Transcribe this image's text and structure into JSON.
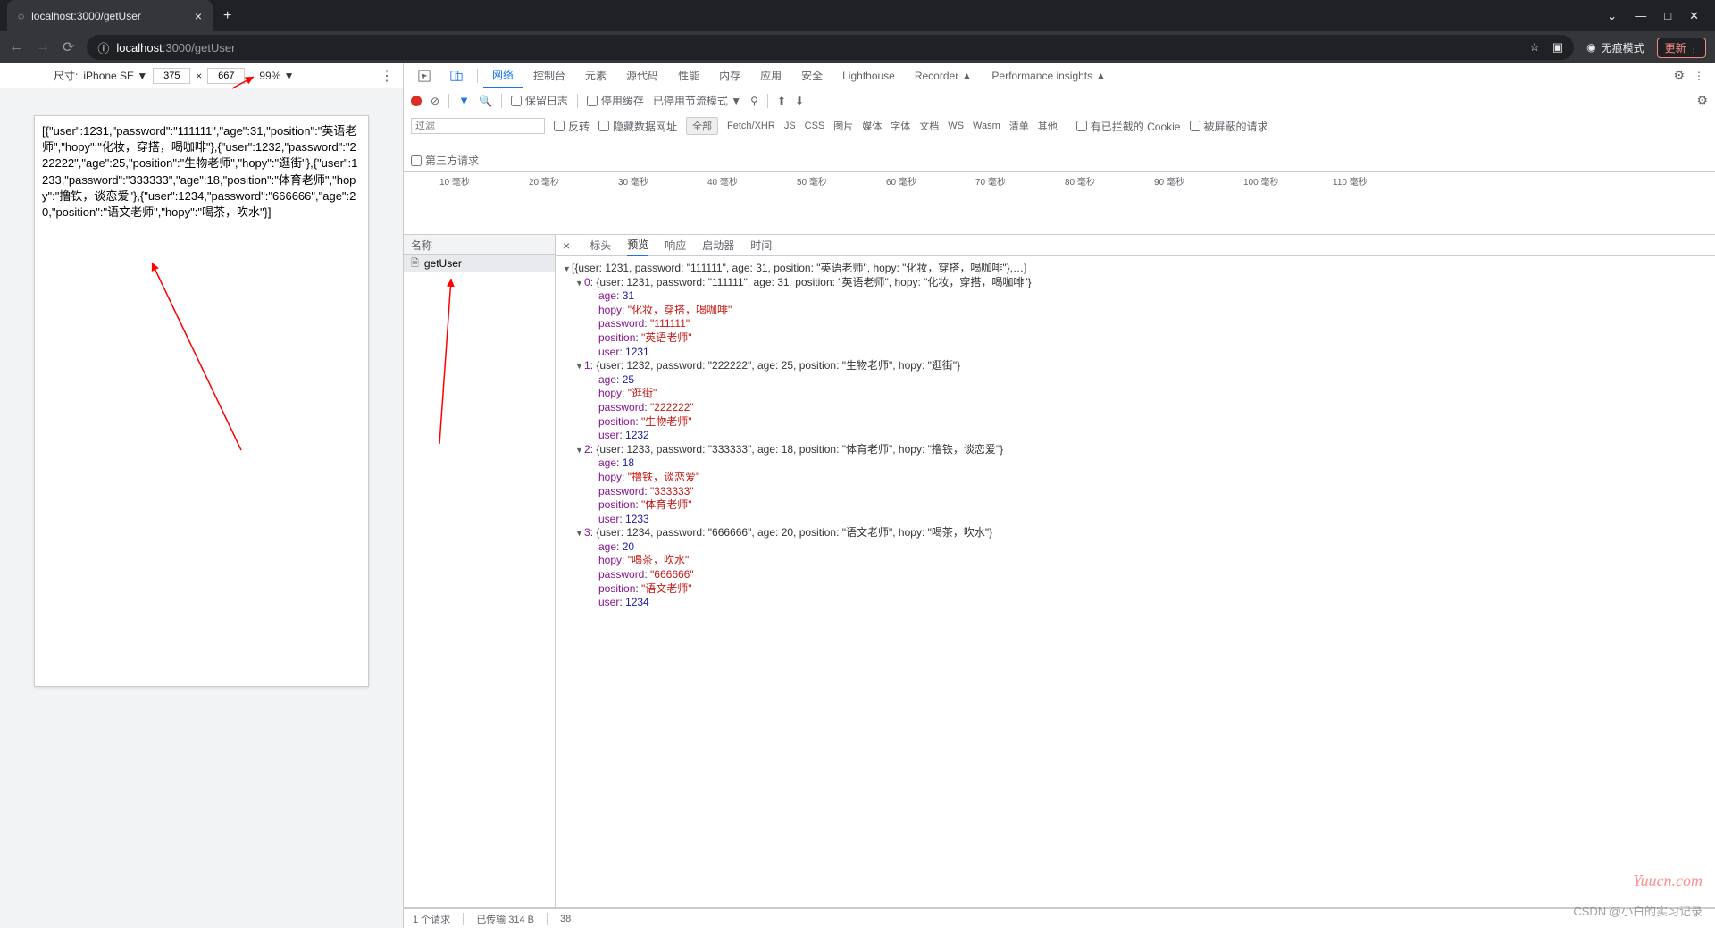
{
  "browser": {
    "tab_title": "localhost:3000/getUser",
    "url_host": "localhost",
    "url_port_path": ":3000/getUser",
    "incognito_label": "无痕模式",
    "update_label": "更新"
  },
  "device_toolbar": {
    "size_label": "尺寸:",
    "device_name": "iPhone SE",
    "width": "375",
    "x": "×",
    "height": "667",
    "zoom": "99%"
  },
  "page_body": "[{\"user\":1231,\"password\":\"111111\",\"age\":31,\"position\":\"英语老师\",\"hopy\":\"化妆，穿搭，喝咖啡\"},{\"user\":1232,\"password\":\"222222\",\"age\":25,\"position\":\"生物老师\",\"hopy\":\"逛街\"},{\"user\":1233,\"password\":\"333333\",\"age\":18,\"position\":\"体育老师\",\"hopy\":\"撸铁，谈恋爱\"},{\"user\":1234,\"password\":\"666666\",\"age\":20,\"position\":\"语文老师\",\"hopy\":\"喝茶，吹水\"}]",
  "devtools": {
    "tabs": [
      "网络",
      "控制台",
      "元素",
      "源代码",
      "性能",
      "内存",
      "应用",
      "安全",
      "Lighthouse",
      "Recorder ▲",
      "Performance insights ▲"
    ],
    "active_tab": "网络",
    "toolbar": {
      "preserve_log": "保留日志",
      "disable_cache": "停用缓存",
      "throttle": "已停用节流模式"
    },
    "filters": {
      "placeholder": "过滤",
      "invert": "反转",
      "hide_data_urls": "隐藏数据网址",
      "all": "全部",
      "types": [
        "Fetch/XHR",
        "JS",
        "CSS",
        "图片",
        "媒体",
        "字体",
        "文档",
        "WS",
        "Wasm",
        "清单",
        "其他"
      ],
      "blocked_cookies": "有已拦截的 Cookie",
      "blocked_requests": "被屏蔽的请求",
      "third_party": "第三方请求"
    },
    "timeline_unit": "毫秒",
    "timeline_marks": [
      10,
      20,
      30,
      40,
      50,
      60,
      70,
      80,
      90,
      100,
      110
    ],
    "request_list": {
      "header": "名称",
      "item": "getUser"
    },
    "detail_tabs": {
      "headers": "标头",
      "preview": "预览",
      "response": "响应",
      "initiator": "启动器",
      "timing": "时间"
    },
    "status": {
      "requests": "1 个请求",
      "transferred": "已传输 314 B",
      "resources": "38"
    }
  },
  "response_data": {
    "summary": "[{user: 1231, password: \"111111\", age: 31, position: \"英语老师\", hopy: \"化妆，穿搭，喝咖啡\"},…]",
    "items": [
      {
        "idx": 0,
        "user": 1231,
        "password": "111111",
        "age": 31,
        "position": "英语老师",
        "hopy": "化妆，穿搭，喝咖啡"
      },
      {
        "idx": 1,
        "user": 1232,
        "password": "222222",
        "age": 25,
        "position": "生物老师",
        "hopy": "逛街"
      },
      {
        "idx": 2,
        "user": 1233,
        "password": "333333",
        "age": 18,
        "position": "体育老师",
        "hopy": "撸铁，谈恋爱"
      },
      {
        "idx": 3,
        "user": 1234,
        "password": "666666",
        "age": 20,
        "position": "语文老师",
        "hopy": "喝茶，吹水"
      }
    ]
  },
  "watermark": "Yuucn.com",
  "csdn": "CSDN @小白的实习记录"
}
